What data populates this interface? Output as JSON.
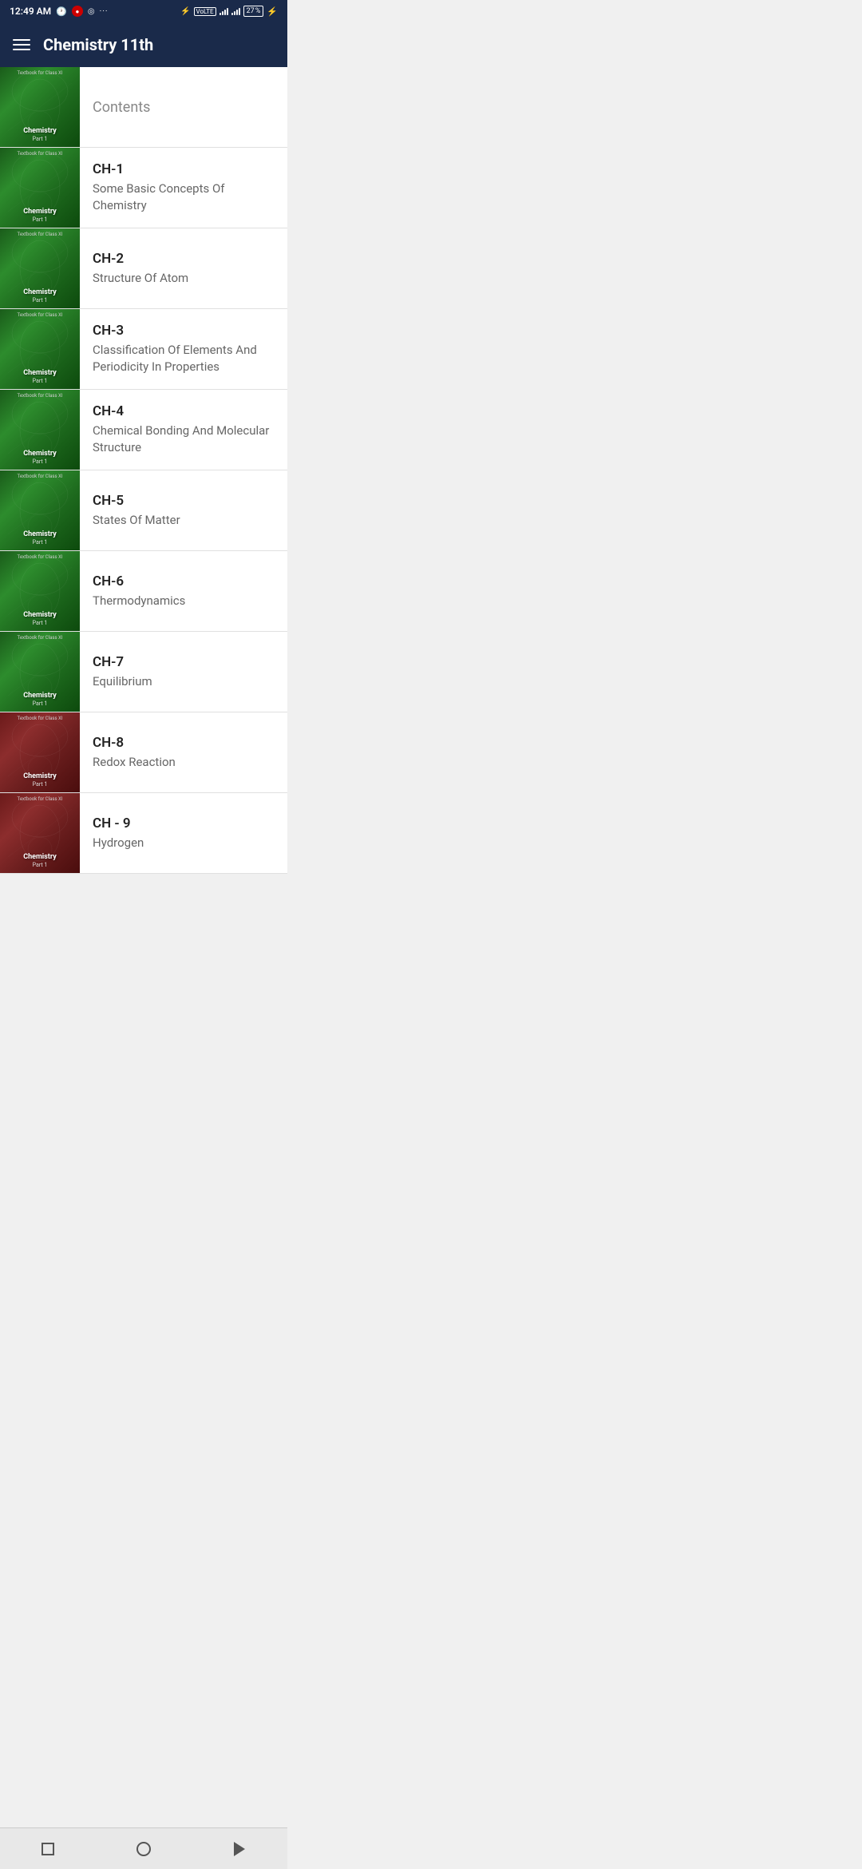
{
  "statusBar": {
    "time": "12:49 AM",
    "battery": "27"
  },
  "appBar": {
    "title": "Chemistry 11th"
  },
  "items": [
    {
      "id": "contents",
      "chapter": "",
      "title": "Contents",
      "coverType": "green",
      "isContents": true
    },
    {
      "id": "ch1",
      "chapter": "CH-1",
      "title": "Some Basic Concepts Of Chemistry",
      "coverType": "green",
      "isContents": false
    },
    {
      "id": "ch2",
      "chapter": "CH-2",
      "title": "Structure Of Atom",
      "coverType": "green",
      "isContents": false
    },
    {
      "id": "ch3",
      "chapter": "CH-3",
      "title": "Classification Of Elements And Periodicity In Properties",
      "coverType": "green",
      "isContents": false
    },
    {
      "id": "ch4",
      "chapter": "CH-4",
      "title": "Chemical Bonding And Molecular Structure",
      "coverType": "green",
      "isContents": false
    },
    {
      "id": "ch5",
      "chapter": "CH-5",
      "title": "States Of Matter",
      "coverType": "green",
      "isContents": false
    },
    {
      "id": "ch6",
      "chapter": "CH-6",
      "title": "Thermodynamics",
      "coverType": "green",
      "isContents": false
    },
    {
      "id": "ch7",
      "chapter": "CH-7",
      "title": "Equilibrium",
      "coverType": "green",
      "isContents": false
    },
    {
      "id": "ch8",
      "chapter": "CH-8",
      "title": "Redox Reaction",
      "coverType": "red",
      "isContents": false
    },
    {
      "id": "ch9",
      "chapter": "CH - 9",
      "title": "Hydrogen",
      "coverType": "red",
      "isContents": false
    }
  ],
  "navbar": {
    "squareLabel": "recent",
    "circleLabel": "home",
    "triangleLabel": "back"
  }
}
